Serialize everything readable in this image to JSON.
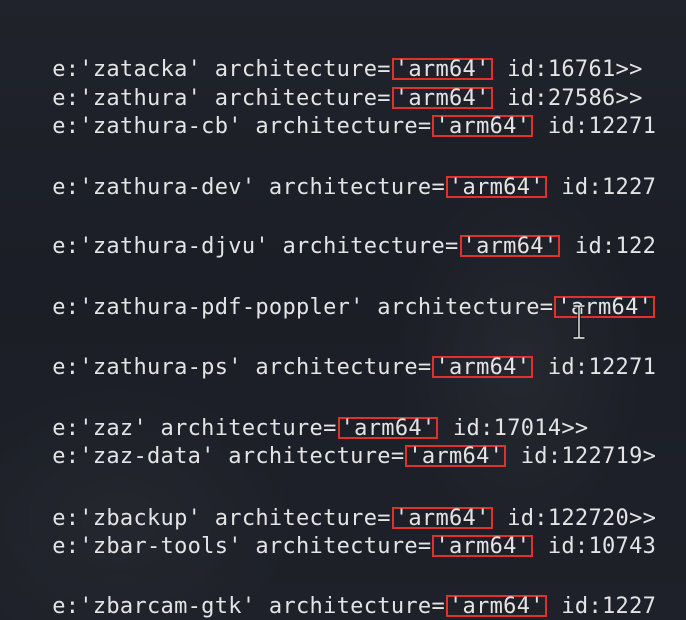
{
  "terminal": {
    "lines": [
      {
        "prefix": "e:'zatacka' architecture=",
        "arch": "'arm64'",
        "suffix": " id:16761>>"
      },
      {
        "prefix": "e:'zathura' architecture=",
        "arch": "'arm64'",
        "suffix": " id:27586>>"
      },
      {
        "prefix": "e:'zathura-cb' architecture=",
        "arch": "'arm64'",
        "suffix": " id:12271"
      },
      {
        "prefix": "e:'zathura-dev' architecture=",
        "arch": "'arm64'",
        "suffix": " id:1227"
      },
      {
        "prefix": "e:'zathura-djvu' architecture=",
        "arch": "'arm64'",
        "suffix": " id:122"
      },
      {
        "prefix": "e:'zathura-pdf-poppler' architecture=",
        "arch": "'arm64'",
        "suffix": ""
      },
      {
        "prefix": "e:'zathura-ps' architecture=",
        "arch": "'arm64'",
        "suffix": " id:12271"
      },
      {
        "prefix": "e:'zaz' architecture=",
        "arch": "'arm64'",
        "suffix": " id:17014>>"
      },
      {
        "prefix": "e:'zaz-data' architecture=",
        "arch": "'arm64'",
        "suffix": " id:122719>"
      },
      {
        "prefix": "e:'zbackup' architecture=",
        "arch": "'arm64'",
        "suffix": " id:122720>>"
      },
      {
        "prefix": "e:'zbar-tools' architecture=",
        "arch": "'arm64'",
        "suffix": " id:10743"
      },
      {
        "prefix": "e:'zbarcam-gtk' architecture=",
        "arch": "'arm64'",
        "suffix": " id:1227"
      }
    ]
  },
  "colors": {
    "background": "#1e2129",
    "text": "#e4e4e4",
    "highlight_box": "#e0312a"
  },
  "cursor": {
    "icon": "text-ibeam-cursor-icon"
  }
}
